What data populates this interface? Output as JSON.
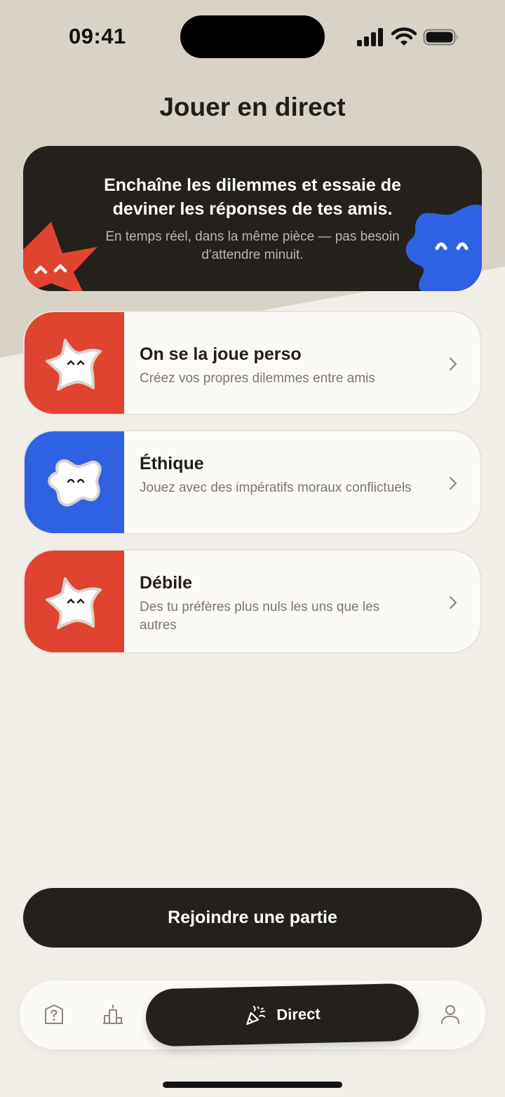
{
  "status_bar": {
    "time": "09:41"
  },
  "page": {
    "title": "Jouer en direct"
  },
  "banner": {
    "title": "Enchaîne les dilemmes et essaie de deviner les réponses de tes amis.",
    "subtitle": "En temps réel, dans la même pièce — pas besoin d'attendre minuit."
  },
  "modes": [
    {
      "title": "On se la joue perso",
      "description": "Créez vos propres dilemmes entre amis",
      "color": "#e0432f",
      "mascot": "star-mascot-icon"
    },
    {
      "title": "Éthique",
      "description": "Jouez avec des impératifs moraux conflictuels",
      "color": "#2f62e3",
      "mascot": "blob-mascot-icon"
    },
    {
      "title": "Débile",
      "description": "Des tu préfères plus nuls les uns que les autres",
      "color": "#e0432f",
      "mascot": "star-mascot-icon"
    }
  ],
  "join_button": {
    "label": "Rejoindre une partie"
  },
  "tab_bar": {
    "active_label": "Direct",
    "tabs": [
      "question-icon",
      "leaderboard-icon",
      "party-popper-icon",
      "profile-icon"
    ]
  },
  "colors": {
    "accent_dark": "#24201c",
    "red": "#e0432f",
    "blue": "#2f62e3",
    "background": "#f1eee8"
  }
}
